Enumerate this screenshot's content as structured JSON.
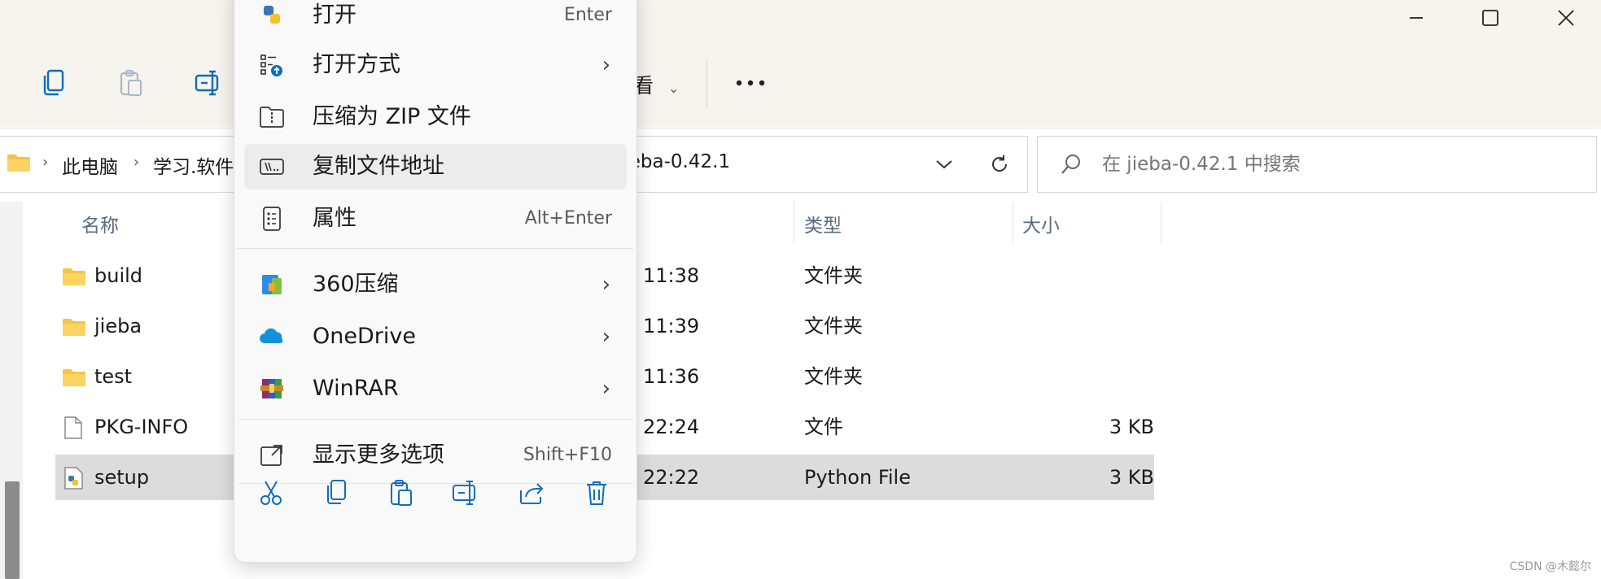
{
  "toolbar": {
    "view_label": "看"
  },
  "address": {
    "crumbs": [
      "此电脑",
      "学习.软件",
      "jieba-0.42.1"
    ]
  },
  "search": {
    "placeholder": "在 jieba-0.42.1 中搜索"
  },
  "columns": {
    "name": "名称",
    "type": "类型",
    "size": "大小"
  },
  "files": [
    {
      "name": "build",
      "time": "11:38",
      "type": "文件夹",
      "size": ""
    },
    {
      "name": "jieba",
      "time": "11:39",
      "type": "文件夹",
      "size": ""
    },
    {
      "name": "test",
      "time": "11:36",
      "type": "文件夹",
      "size": ""
    },
    {
      "name": "PKG-INFO",
      "time": "22:24",
      "type": "文件",
      "size": "3 KB"
    },
    {
      "name": "setup",
      "time": "22:22",
      "type": "Python File",
      "size": "3 KB"
    }
  ],
  "context_menu": {
    "open": {
      "label": "打开",
      "shortcut": "Enter"
    },
    "open_with": {
      "label": "打开方式"
    },
    "compress_zip": {
      "label": "压缩为 ZIP 文件"
    },
    "copy_path": {
      "label": "复制文件地址"
    },
    "properties": {
      "label": "属性",
      "shortcut": "Alt+Enter"
    },
    "zip360": {
      "label": "360压缩"
    },
    "onedrive": {
      "label": "OneDrive"
    },
    "winrar": {
      "label": "WinRAR"
    },
    "more_options": {
      "label": "显示更多选项",
      "shortcut": "Shift+F10"
    }
  },
  "watermark": "CSDN @木懿尔",
  "colors": {
    "accent": "#0f6cbd",
    "folder": "#f6c440",
    "selection": "#dcdcdc"
  }
}
